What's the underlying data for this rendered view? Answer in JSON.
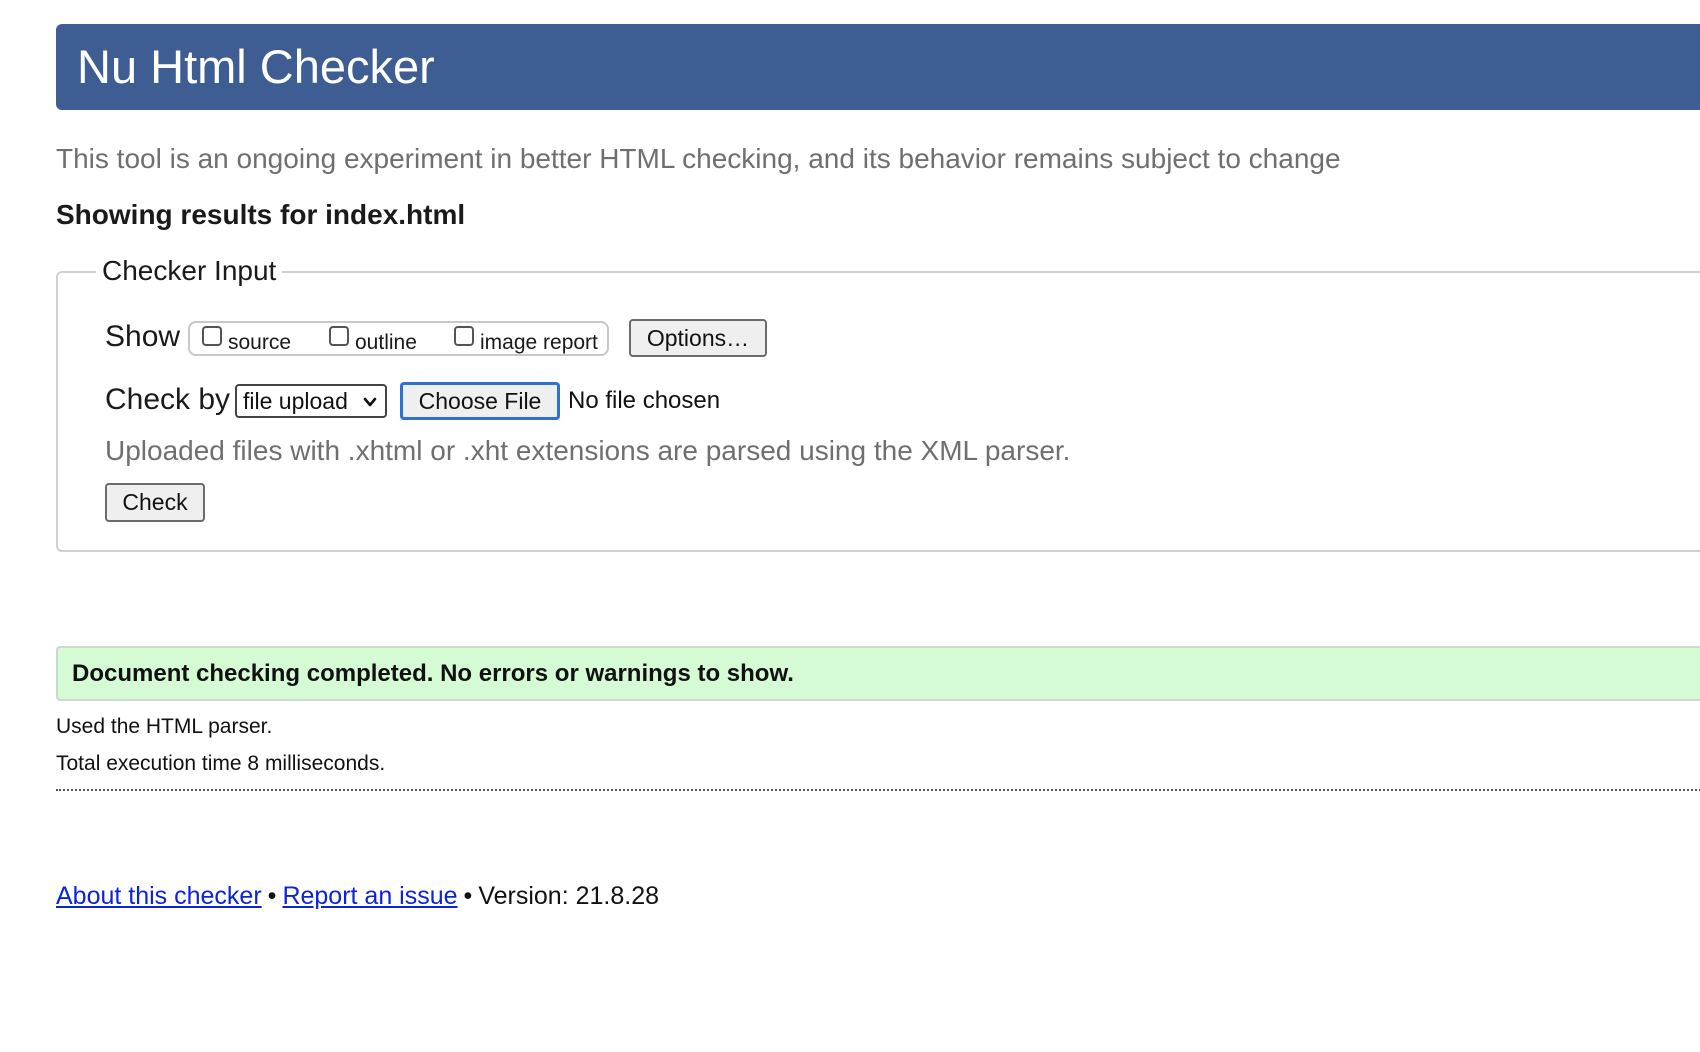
{
  "header": {
    "title": "Nu Html Checker",
    "bar_color": "#3e5d93"
  },
  "tagline": "This tool is an ongoing experiment in better HTML checking, and its behavior remains subject to change",
  "results_heading": "Showing results for index.html",
  "checker_input": {
    "legend": "Checker Input",
    "show_label": "Show",
    "show_options": [
      {
        "label": "source",
        "checked": false
      },
      {
        "label": "outline",
        "checked": false
      },
      {
        "label": "image report",
        "checked": false
      }
    ],
    "options_button": "Options…",
    "check_by_label": "Check by",
    "check_by_selected": "file upload",
    "choose_file_button": "Choose File",
    "no_file_text": "No file chosen",
    "upload_note": "Uploaded files with .xhtml or .xht extensions are parsed using the XML parser.",
    "check_button": "Check"
  },
  "result": {
    "success_message": "Document checking completed. No errors or warnings to show.",
    "success_color": "#d4fbd4",
    "parser_line": "Used the HTML parser.",
    "time_line": "Total execution time 8 milliseconds."
  },
  "footer": {
    "about_link": "About this checker",
    "separator": "•",
    "report_link": "Report an issue",
    "version_text": "Version: 21.8.28",
    "link_color": "#0b24d6"
  }
}
